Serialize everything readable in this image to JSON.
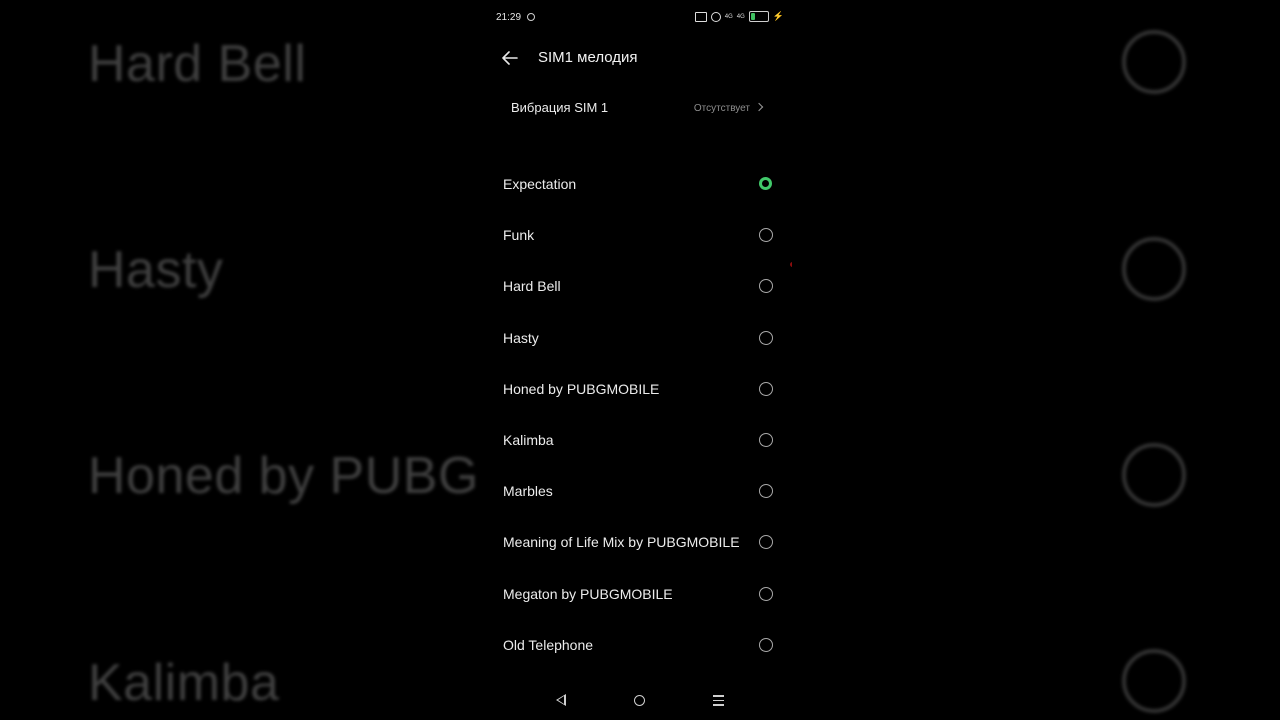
{
  "status_bar": {
    "time": "21:29",
    "network_left": "4G",
    "network_right": "4G",
    "battery_level": "23",
    "battery_fraction": 0.23,
    "icons": [
      "cast-icon",
      "alarm-icon",
      "signal-icon",
      "signal-icon",
      "battery-icon",
      "charging-icon"
    ]
  },
  "header": {
    "title": "SIM1 мелодия",
    "back_icon": "arrow-left-icon"
  },
  "vibration": {
    "label": "Вибрация SIM 1",
    "value": "Отсутствует"
  },
  "ringtones": [
    {
      "name": "Expectation",
      "selected": true
    },
    {
      "name": "Funk",
      "selected": false
    },
    {
      "name": "Hard Bell",
      "selected": false
    },
    {
      "name": "Hasty",
      "selected": false
    },
    {
      "name": "Honed by PUBGMOBILE",
      "selected": false
    },
    {
      "name": "Kalimba",
      "selected": false
    },
    {
      "name": "Marbles",
      "selected": false
    },
    {
      "name": "Meaning of Life Mix by PUBGMOBILE",
      "selected": false
    },
    {
      "name": "Megaton by PUBGMOBILE",
      "selected": false
    },
    {
      "name": "Old Telephone",
      "selected": false
    }
  ],
  "background": {
    "items": [
      "Hard Bell",
      "Hasty",
      "Honed by PUBG",
      "Kalimba"
    ]
  },
  "colors": {
    "accent": "#41c96a",
    "background": "#000000",
    "text": "#ececec",
    "secondary_text": "#8e8e8e"
  }
}
